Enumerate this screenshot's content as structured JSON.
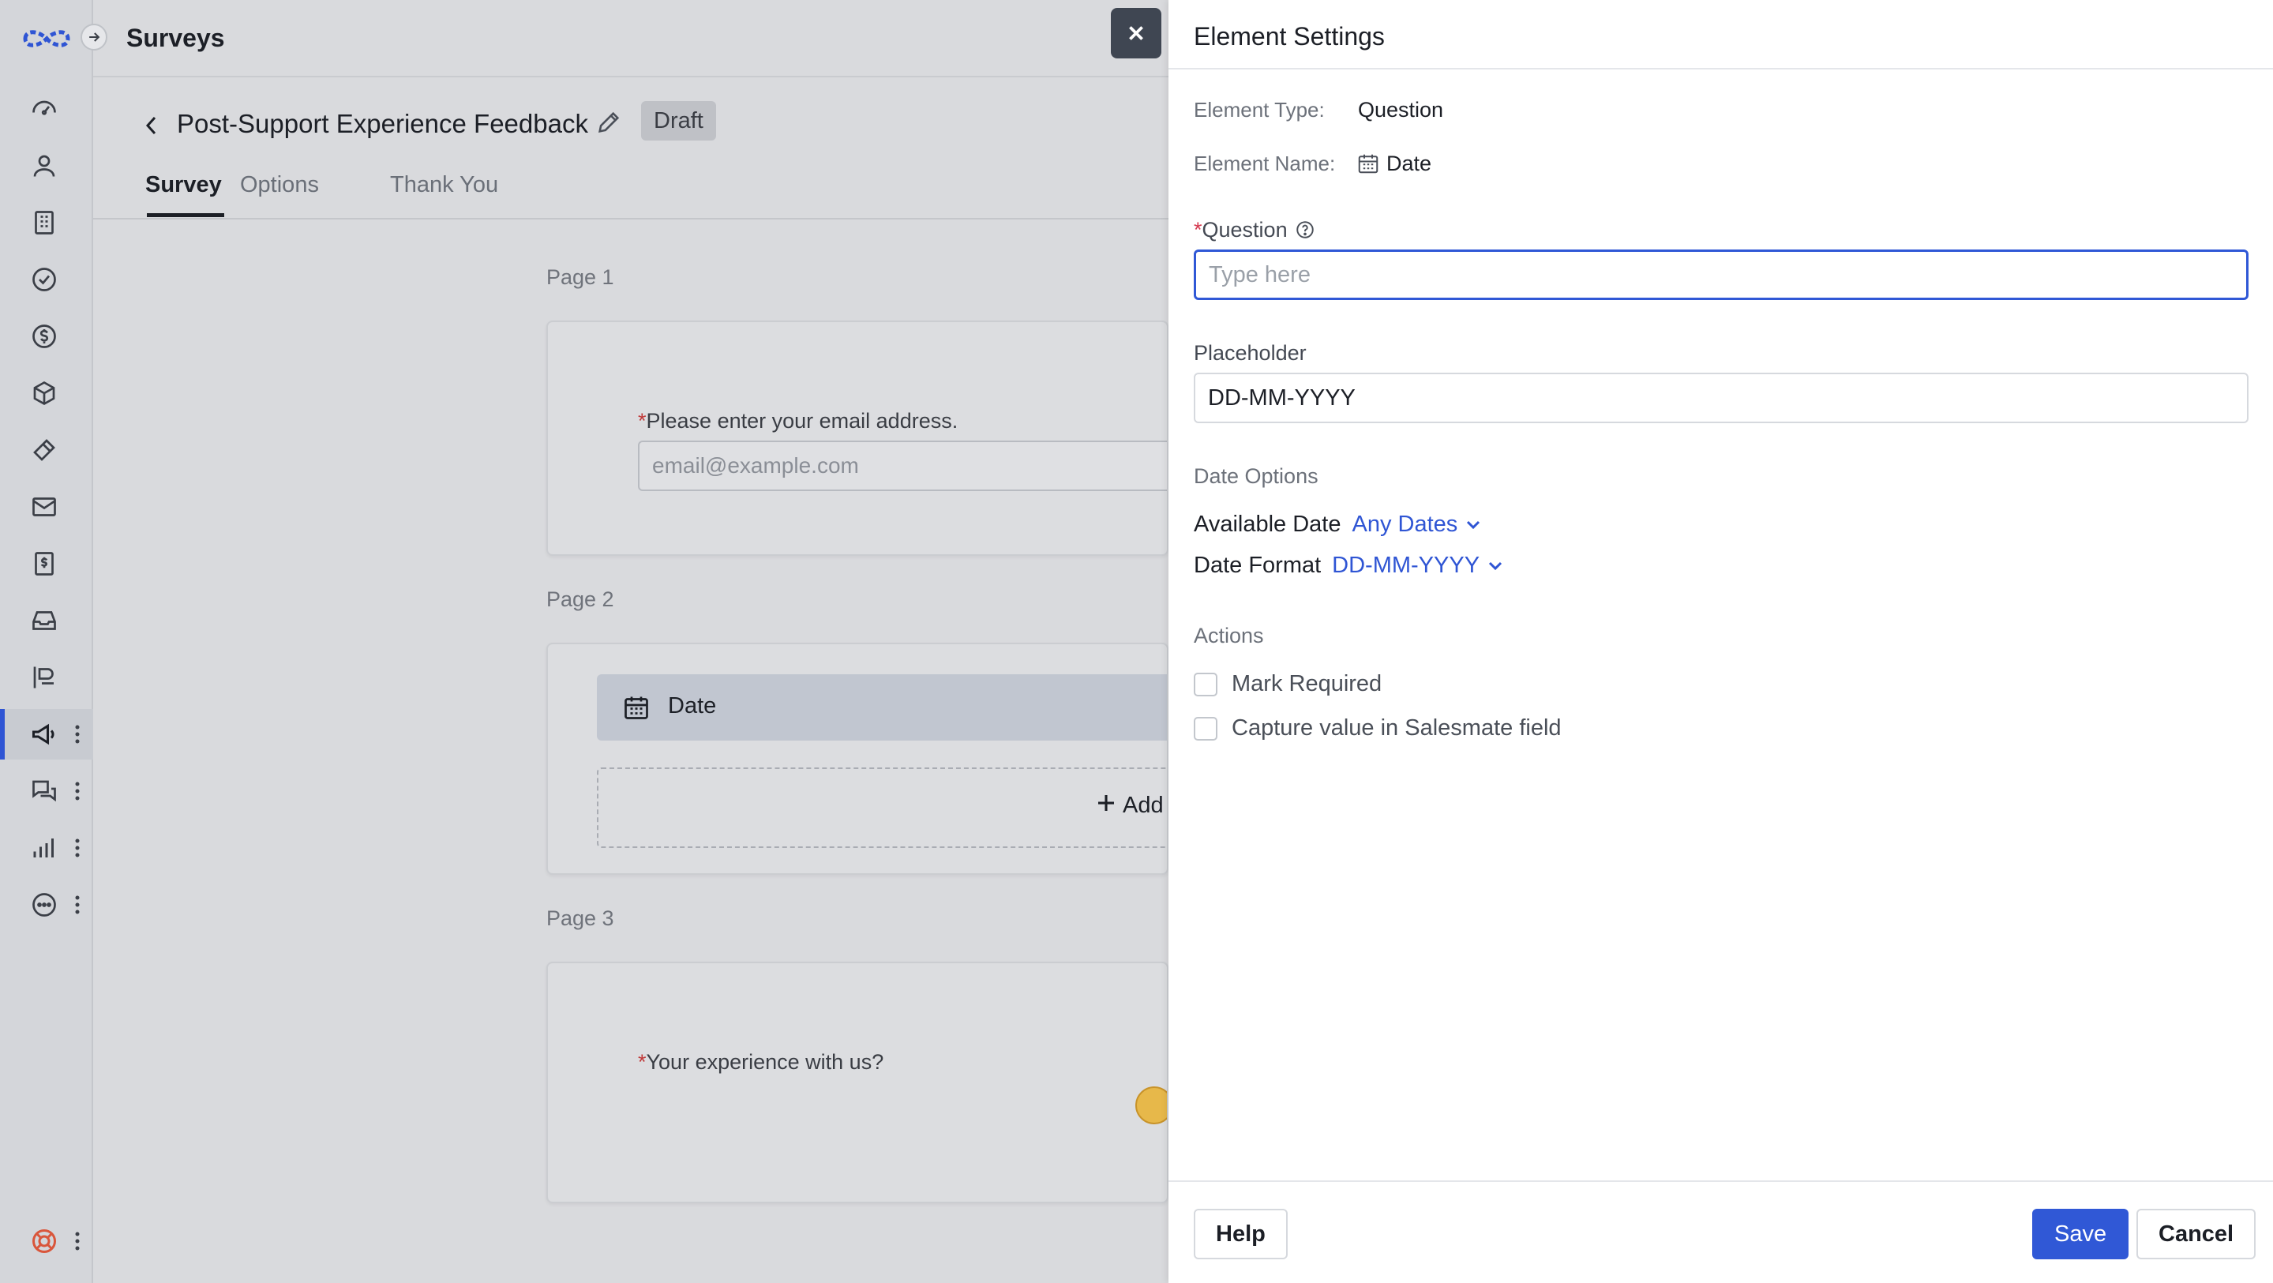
{
  "app": {
    "title": "Surveys"
  },
  "sidebar": {
    "items": [
      {
        "icon": "dashboard-icon"
      },
      {
        "icon": "contacts-icon"
      },
      {
        "icon": "companies-icon"
      },
      {
        "icon": "tasks-icon"
      },
      {
        "icon": "deals-icon"
      },
      {
        "icon": "products-icon"
      },
      {
        "icon": "tickets-icon"
      },
      {
        "icon": "email-icon"
      },
      {
        "icon": "quotes-icon"
      },
      {
        "icon": "inbox-icon"
      },
      {
        "icon": "sequences-icon"
      },
      {
        "icon": "campaigns-icon",
        "active": true
      },
      {
        "icon": "conversations-icon"
      },
      {
        "icon": "reports-icon"
      },
      {
        "icon": "more-icon"
      }
    ],
    "bottom_icon": "help-center-icon"
  },
  "survey": {
    "title": "Post-Support Experience Feedback",
    "status": "Draft",
    "tabs": [
      {
        "label": "Survey",
        "active": true
      },
      {
        "label": "Options"
      },
      {
        "label": "Thank You"
      }
    ],
    "pages": [
      {
        "label": "Page 1",
        "question": "Please enter your email address.",
        "input_placeholder": "email@example.com"
      },
      {
        "label": "Page 2",
        "element": "Date",
        "add_label": "Add"
      },
      {
        "label": "Page 3",
        "question": "Your experience with us?"
      }
    ]
  },
  "panel": {
    "title": "Element Settings",
    "element_type_label": "Element Type:",
    "element_type_value": "Question",
    "element_name_label": "Element Name:",
    "element_name_value": "Date",
    "question_label": "Question",
    "question_placeholder": "Type here",
    "question_value": "",
    "placeholder_label": "Placeholder",
    "placeholder_value": "DD-MM-YYYY",
    "date_options_label": "Date Options",
    "available_date_label": "Available Date",
    "available_date_value": "Any Dates",
    "date_format_label": "Date Format",
    "date_format_value": "DD-MM-YYYY",
    "actions_label": "Actions",
    "mark_required_label": "Mark Required",
    "capture_value_label": "Capture value in Salesmate field",
    "help_button": "Help",
    "save_button": "Save",
    "cancel_button": "Cancel"
  },
  "colors": {
    "accent": "#3058d6",
    "link": "#2f55d4",
    "required": "#d4384e",
    "close_button_bg": "#3f4652"
  }
}
